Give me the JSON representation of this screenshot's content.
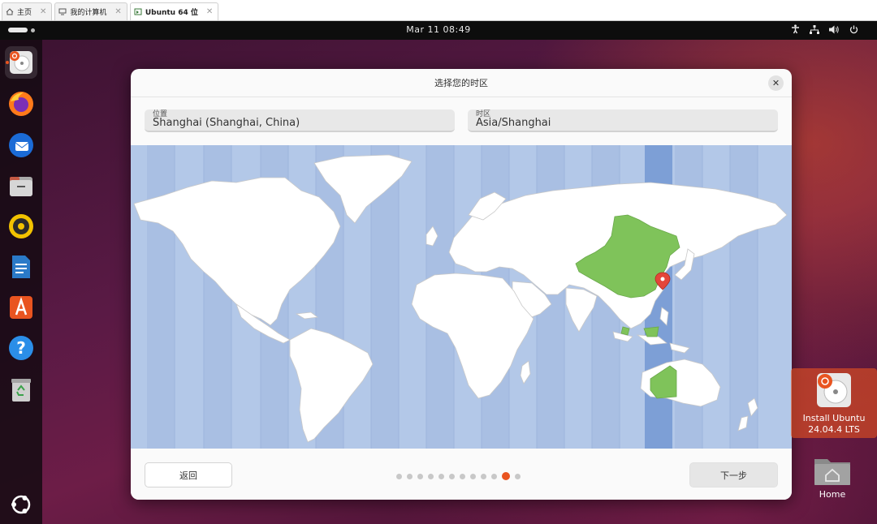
{
  "vm_tabs": [
    {
      "label": "主页",
      "icon": "home-icon",
      "active": false
    },
    {
      "label": "我的计算机",
      "icon": "computer-icon",
      "active": false
    },
    {
      "label": "Ubuntu 64 位",
      "icon": "vm-icon",
      "active": true
    }
  ],
  "topbar": {
    "clock": "Mar 11  08:49",
    "tray_icons": [
      "accessibility-icon",
      "network-icon",
      "volume-icon",
      "power-icon"
    ]
  },
  "dock": {
    "items": [
      {
        "name": "installer",
        "icon": "installer-icon",
        "active": true
      },
      {
        "name": "firefox",
        "icon": "firefox-icon"
      },
      {
        "name": "thunderbird",
        "icon": "thunderbird-icon"
      },
      {
        "name": "files",
        "icon": "files-icon"
      },
      {
        "name": "rhythmbox",
        "icon": "rhythmbox-icon"
      },
      {
        "name": "writer",
        "icon": "writer-icon"
      },
      {
        "name": "app-center",
        "icon": "app-center-icon"
      },
      {
        "name": "help",
        "icon": "help-icon"
      },
      {
        "name": "trash",
        "icon": "trash-icon"
      },
      {
        "name": "show-apps",
        "icon": "ubuntu-logo-icon"
      }
    ]
  },
  "dialog": {
    "title": "选择您的时区",
    "location": {
      "label": "位置",
      "value": "Shanghai (Shanghai, China)"
    },
    "timezone": {
      "label": "时区",
      "value": "Asia/Shanghai"
    },
    "back_label": "返回",
    "next_label": "下一步",
    "progress": {
      "total_steps": 12,
      "current_step": 11
    }
  },
  "desktop_icons": {
    "install": {
      "label": "Install Ubuntu 24.04.4 LTS"
    },
    "home": {
      "label": "Home"
    }
  },
  "colors": {
    "accent": "#e95420",
    "map_ocean": "#b3c8e8",
    "map_highlight": "#7fc35a",
    "timezone_band": "#7d9fd6"
  }
}
